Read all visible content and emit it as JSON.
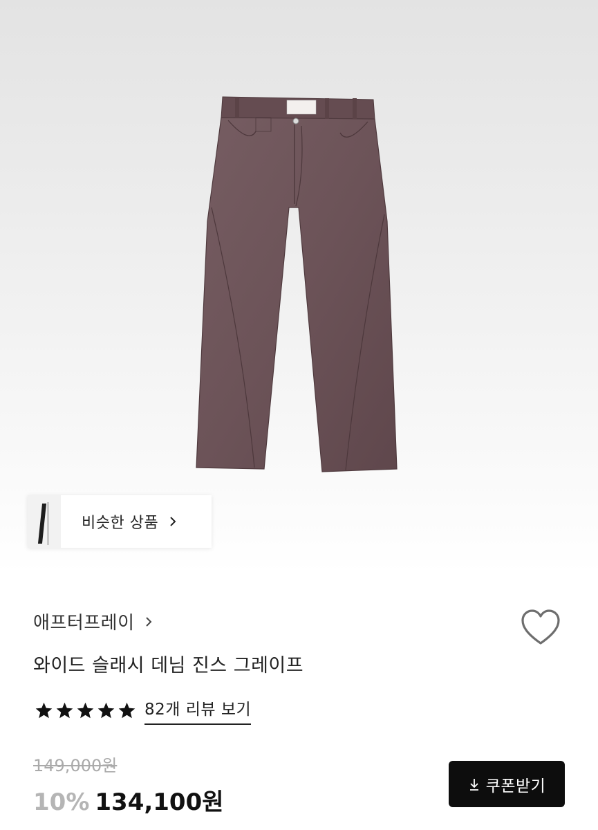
{
  "product": {
    "image_icon": "jeans-image",
    "similar_label": "비슷한 상품",
    "brand": "애프터프레이",
    "title": "와이드 슬래시 데님 진스 그레이프",
    "rating": 5,
    "rating_max": 5,
    "review_link": "82개 리뷰 보기",
    "original_price": "149,000원",
    "discount": "10%",
    "price": "134,100원",
    "coupon_label": "쿠폰받기"
  },
  "colors": {
    "pants": "#6f565b",
    "button_bg": "#0d0d0d",
    "discount": "#b5b5b5"
  },
  "icons": {
    "similar": "chevron-right-icon",
    "brand": "chevron-right-icon",
    "favorite": "heart-outline-icon",
    "star": "star-icon",
    "coupon": "download-arrow-icon"
  }
}
